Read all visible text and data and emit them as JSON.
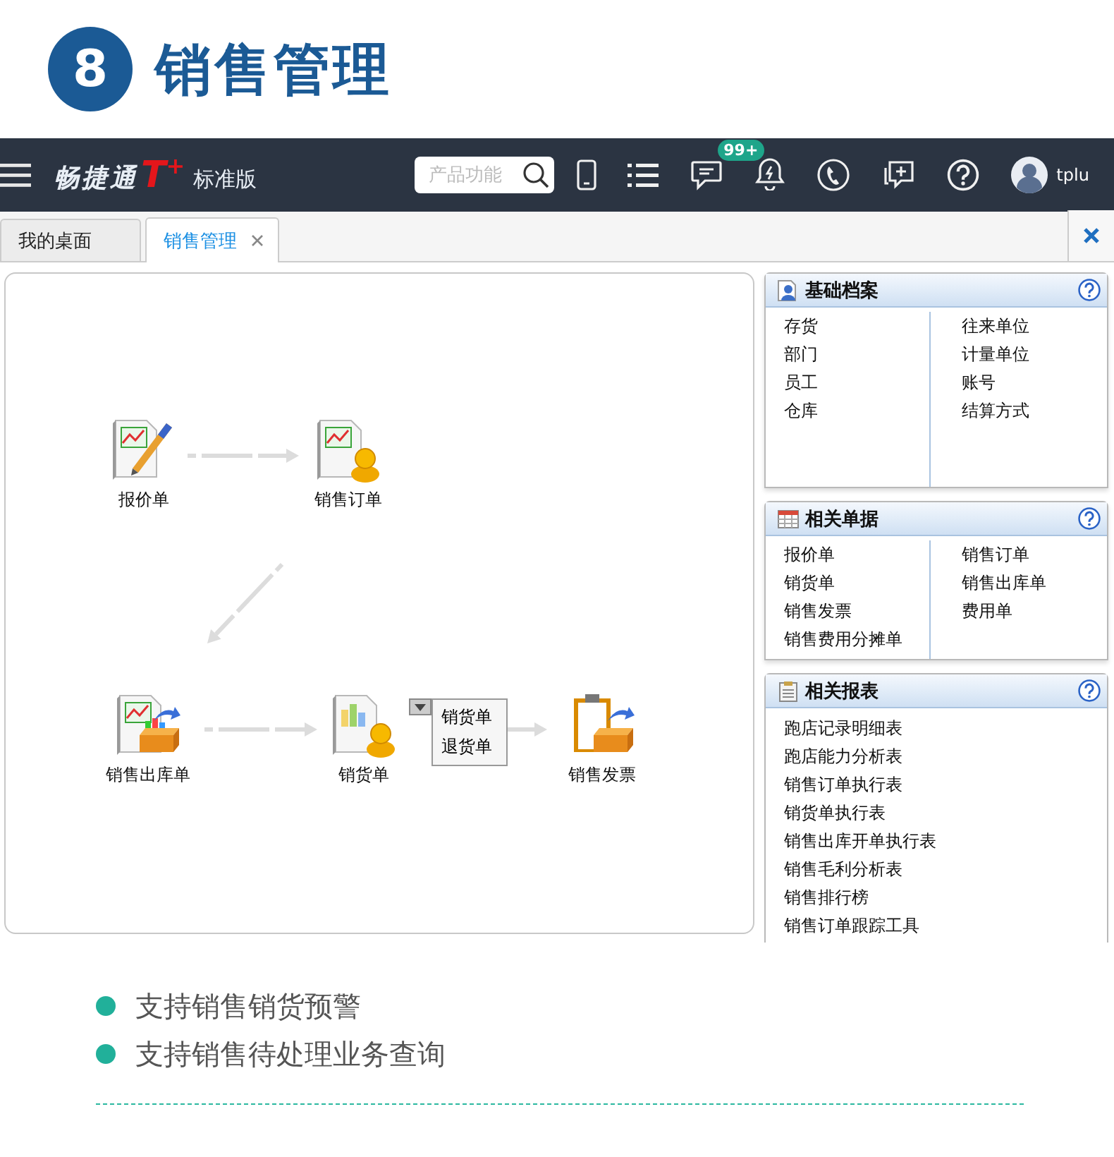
{
  "heading": {
    "number": "8",
    "title": "销售管理"
  },
  "app": {
    "brand": {
      "name": "畅捷通",
      "mark": "T$^{+}$",
      "edition": "标准版"
    },
    "search": {
      "placeholder": "产品功能"
    },
    "notification_badge": "99+",
    "user": "tplu"
  },
  "tabs": [
    {
      "label": "我的桌面",
      "selected": false,
      "closable": false
    },
    {
      "label": "销售管理",
      "selected": true,
      "closable": true
    }
  ],
  "flow": {
    "nodes": [
      {
        "label": "报价单",
        "kind": "quote"
      },
      {
        "label": "销售订单",
        "kind": "order"
      },
      {
        "label": "销售出库单",
        "kind": "outbound"
      },
      {
        "label": "销货单",
        "kind": "delivery"
      },
      {
        "label": "销售发票",
        "kind": "invoice"
      }
    ],
    "menu": [
      "销货单",
      "退货单"
    ]
  },
  "panels": [
    {
      "title": "基础档案",
      "kind": "archive",
      "columns": [
        [
          "存货",
          "部门",
          "员工",
          "仓库"
        ],
        [
          "往来单位",
          "计量单位",
          "账号",
          "结算方式"
        ]
      ]
    },
    {
      "title": "相关单据",
      "kind": "documents",
      "columns": [
        [
          "报价单",
          "销货单",
          "销售发票",
          "销售费用分摊单"
        ],
        [
          "销售订单",
          "销售出库单",
          "费用单"
        ]
      ]
    },
    {
      "title": "相关报表",
      "kind": "reports",
      "items": [
        "跑店记录明细表",
        "跑店能力分析表",
        "销售订单执行表",
        "销货单执行表",
        "销售出库开单执行表",
        "销售毛利分析表",
        "销售排行榜",
        "销售订单跟踪工具"
      ]
    }
  ],
  "features": [
    "支持销售销货预警",
    "支持销售待处理业务查询"
  ]
}
